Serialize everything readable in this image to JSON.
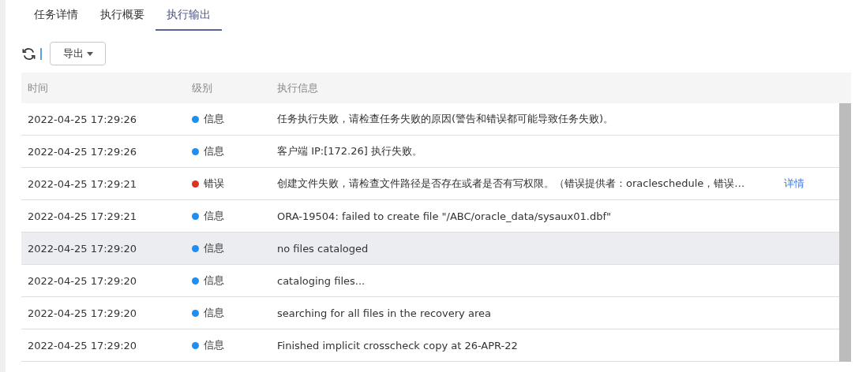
{
  "tabs": [
    {
      "label": "任务详情",
      "selected": false
    },
    {
      "label": "执行概要",
      "selected": false
    },
    {
      "label": "执行输出",
      "selected": true
    }
  ],
  "toolbar": {
    "export_button": "导出"
  },
  "table": {
    "columns": [
      "时间",
      "级别",
      "执行信息"
    ],
    "rows": [
      {
        "time": "2022-04-25 17:29:26",
        "level": "信息",
        "color": "#1e8ff0",
        "message": "任务执行失败，请检查任务失败的原因(警告和错误都可能导致任务失败)。",
        "selected": false
      },
      {
        "time": "2022-04-25 17:29:26",
        "level": "信息",
        "color": "#1e8ff0",
        "message": "客户端 IP:[172.26] 执行失败。",
        "selected": false
      },
      {
        "time": "2022-04-25 17:29:21",
        "level": "错误",
        "color": "#dd3322",
        "message": "创建文件失败，请检查文件路径是否存在或者是否有写权限。（错误提供者：oracleschedule，错误…",
        "link": "详情",
        "selected": false
      },
      {
        "time": "2022-04-25 17:29:21",
        "level": "信息",
        "color": "#1e8ff0",
        "message": "ORA-19504: failed to create file \"/ABC/oracle_data/sysaux01.dbf\"",
        "selected": false
      },
      {
        "time": "2022-04-25 17:29:20",
        "level": "信息",
        "color": "#1e8ff0",
        "message": "no files cataloged",
        "selected": true
      },
      {
        "time": "2022-04-25 17:29:20",
        "level": "信息",
        "color": "#1e8ff0",
        "message": "cataloging files...",
        "selected": false
      },
      {
        "time": "2022-04-25 17:29:20",
        "level": "信息",
        "color": "#1e8ff0",
        "message": "searching for all files in the recovery area",
        "selected": false
      },
      {
        "time": "2022-04-25 17:29:20",
        "level": "信息",
        "color": "#1e8ff0",
        "message": "Finished implicit crosscheck copy at 26-APR-22",
        "selected": false
      }
    ]
  }
}
